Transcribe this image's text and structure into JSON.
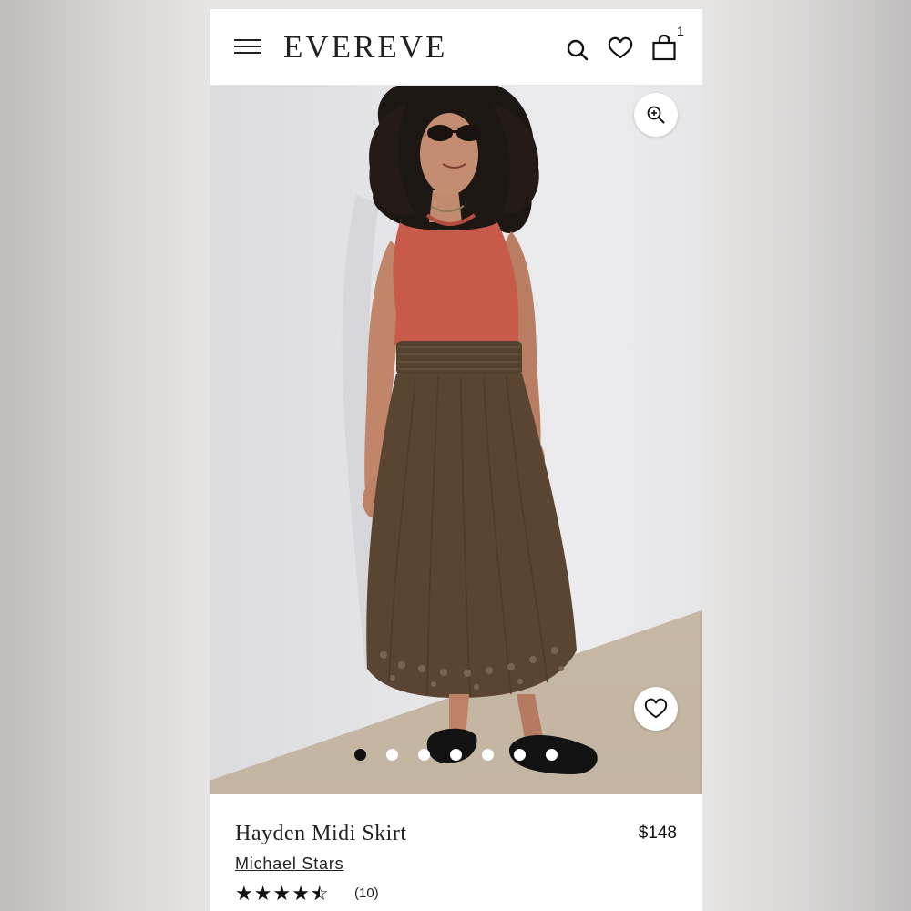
{
  "header": {
    "brand": "EVEREVE",
    "cart_count": "1",
    "icons": [
      "menu-icon",
      "search-icon",
      "heart-icon",
      "shopping-bag-icon"
    ]
  },
  "gallery": {
    "image_alt": "Model wearing Hayden Midi Skirt",
    "slide_count": 7,
    "active_slide": 1,
    "icons": [
      "zoom-in-icon",
      "heart-icon"
    ]
  },
  "product": {
    "name": "Hayden Midi Skirt",
    "brand": "Michael Stars",
    "price": "$148",
    "rating": 4.5,
    "review_count": "(10)"
  },
  "colors": {
    "background": "#e6e5e4",
    "tank_top": "#c85a4a",
    "skirt": "#5a4533",
    "text": "#222222"
  }
}
